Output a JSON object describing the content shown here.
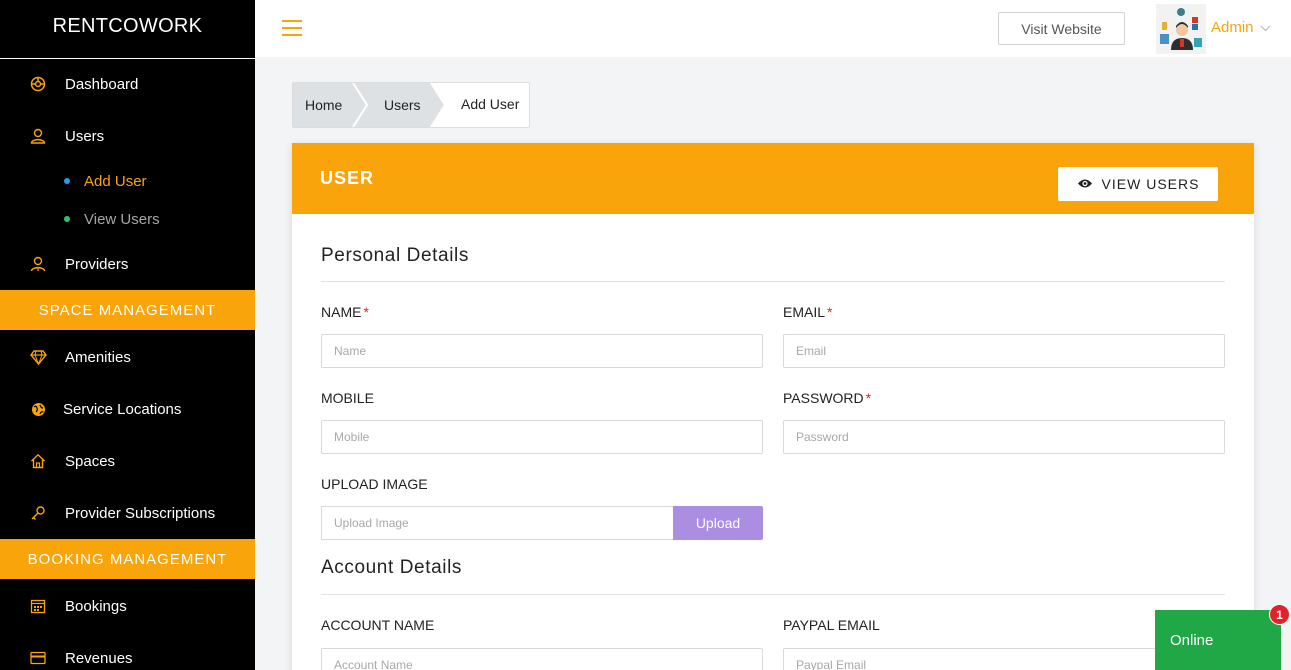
{
  "app": {
    "brand": "RENTCOWORK"
  },
  "sidebar": {
    "items": [
      {
        "label": "Dashboard",
        "icon": "dashboard-icon"
      },
      {
        "label": "Users",
        "icon": "user-icon"
      },
      {
        "label": "Providers",
        "icon": "providers-icon"
      },
      {
        "label": "Amenities",
        "icon": "diamond-icon"
      },
      {
        "label": "Service Locations",
        "icon": "globe-icon"
      },
      {
        "label": "Spaces",
        "icon": "home-icon"
      },
      {
        "label": "Provider Subscriptions",
        "icon": "key-icon"
      },
      {
        "label": "Bookings",
        "icon": "calendar-icon"
      },
      {
        "label": "Revenues",
        "icon": "card-icon"
      }
    ],
    "sub_items": [
      {
        "label": "Add User",
        "active": true,
        "dot_color": "#1e9ff2",
        "text_color": "#f9a40a"
      },
      {
        "label": "View Users",
        "active": false,
        "dot_color": "#28c76f",
        "text_color": "#a6a6a6"
      }
    ],
    "sections": {
      "space": "SPACE MANAGEMENT",
      "booking": "BOOKING MANAGEMENT"
    }
  },
  "header": {
    "visit_label": "Visit Website",
    "user_name": "Admin"
  },
  "breadcrumb": [
    "Home",
    "Users",
    "Add User"
  ],
  "card": {
    "title": "USER",
    "view_users_label": "VIEW USERS",
    "personal_title": "Personal Details",
    "account_title": "Account Details",
    "fields": {
      "name": {
        "label": "NAME",
        "placeholder": "Name",
        "required": true
      },
      "email": {
        "label": "EMAIL",
        "placeholder": "Email",
        "required": true
      },
      "mobile": {
        "label": "MOBILE",
        "placeholder": "Mobile",
        "required": false
      },
      "password": {
        "label": "PASSWORD",
        "placeholder": "Password",
        "required": true
      },
      "upload": {
        "label": "UPLOAD IMAGE",
        "placeholder": "Upload Image",
        "button": "Upload"
      },
      "account_name": {
        "label": "ACCOUNT NAME",
        "placeholder": "Account Name"
      },
      "paypal_email": {
        "label": "PAYPAL EMAIL",
        "placeholder": "Paypal Email"
      }
    },
    "required_mark": "*"
  },
  "chat": {
    "status": "Online",
    "count": "1"
  },
  "colors": {
    "accent": "#f9a40a",
    "upload": "#ab8ee2",
    "online": "#1fa845",
    "badge": "#e0222d"
  }
}
